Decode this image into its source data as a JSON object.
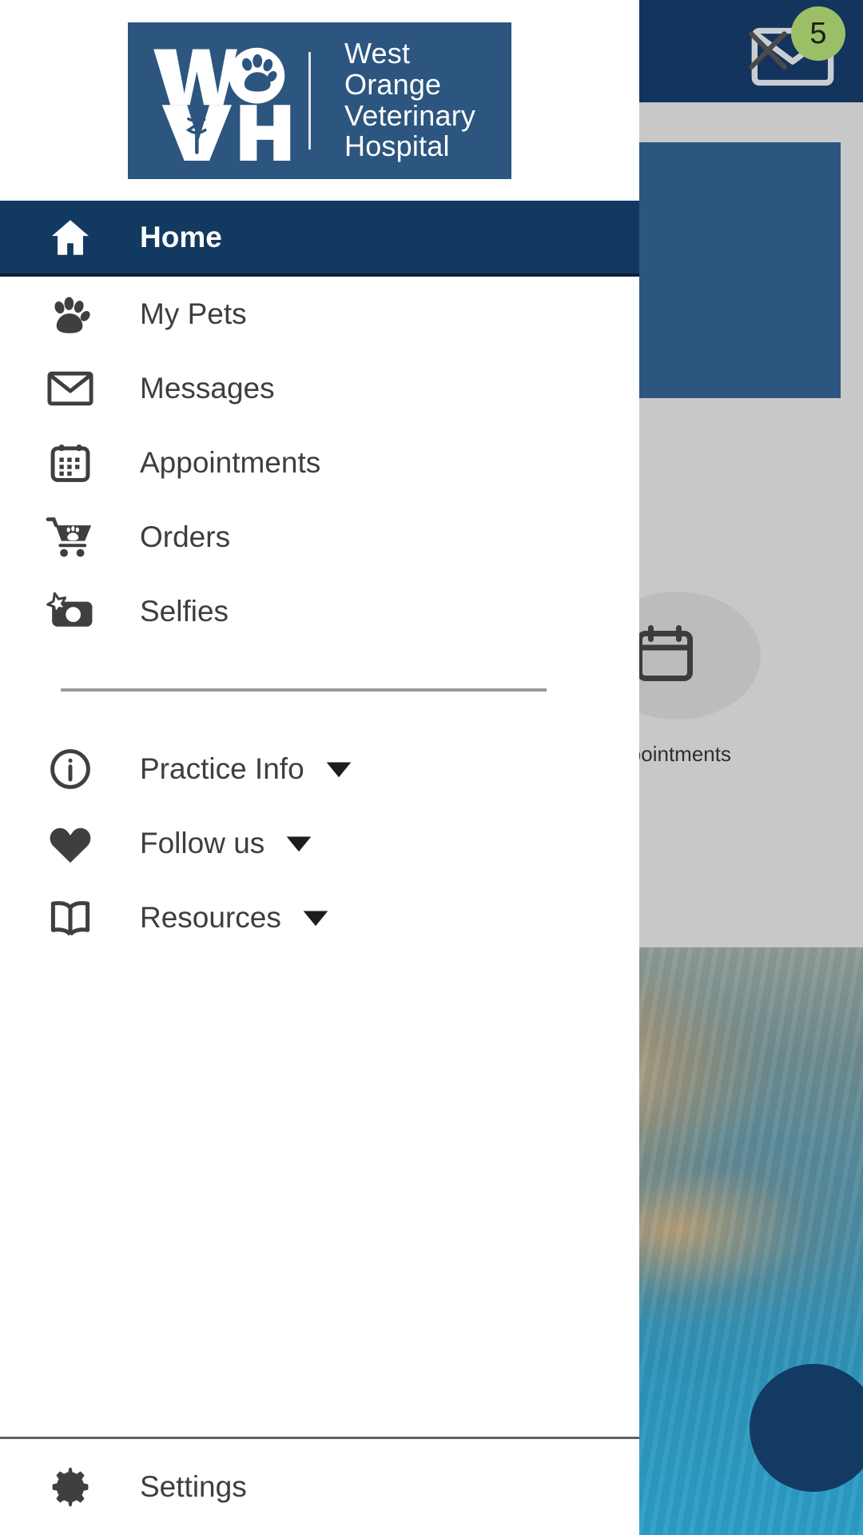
{
  "app": {
    "background": {
      "appbar": {
        "mail_icon": "mail-icon",
        "badge_count": "5",
        "badge_color": "#9bbf66",
        "bar_color": "#13345c"
      },
      "tiles": [
        {
          "icon": "calendar-icon",
          "label": "Appointments"
        }
      ],
      "photo_alt": "dog-swimming-photo",
      "fab": {
        "icon": "floating-action-button",
        "color": "#133a63"
      }
    }
  },
  "drawer": {
    "close_label": "✕",
    "close_icon": "close-icon",
    "logo": {
      "monogram": "WOVH",
      "monogram_letters": [
        "W",
        "O",
        "V",
        "H"
      ],
      "title_line1": "West Orange",
      "title_line2": "Veterinary",
      "title_line3": "Hospital",
      "background_color": "#2c567f",
      "paw_icon": "paw-icon",
      "caduceus_icon": "caduceus-icon"
    },
    "nav": {
      "primary": [
        {
          "label": "Home",
          "icon": "home-icon",
          "active": true,
          "has_caret": false
        },
        {
          "label": "My Pets",
          "icon": "paw-icon",
          "active": false,
          "has_caret": false
        },
        {
          "label": "Messages",
          "icon": "mail-icon",
          "active": false,
          "has_caret": false
        },
        {
          "label": "Appointments",
          "icon": "calendar-icon",
          "active": false,
          "has_caret": false
        },
        {
          "label": "Orders",
          "icon": "cart-paw-icon",
          "active": false,
          "has_caret": false
        },
        {
          "label": "Selfies",
          "icon": "camera-star-icon",
          "active": false,
          "has_caret": false
        }
      ],
      "secondary": [
        {
          "label": "Practice Info",
          "icon": "info-icon",
          "has_caret": true
        },
        {
          "label": "Follow us",
          "icon": "heart-icon",
          "has_caret": true
        },
        {
          "label": "Resources",
          "icon": "book-icon",
          "has_caret": true
        }
      ],
      "footer": [
        {
          "label": "Settings",
          "icon": "gear-icon"
        }
      ]
    },
    "colors": {
      "active_background": "#123a61",
      "active_text": "#ffffff",
      "text": "#3e3e3e",
      "brand": "#2c567f",
      "divider": "#9a9a9a"
    }
  }
}
